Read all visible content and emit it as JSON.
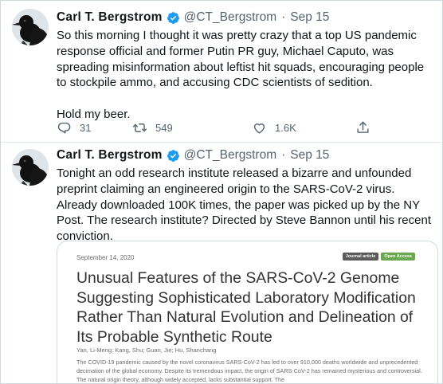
{
  "tweets": [
    {
      "author": "Carl T. Bergstrom",
      "handle": "@CT_Bergstrom",
      "separator": "·",
      "date": "Sep 15",
      "text": "So this morning I thought it was pretty crazy that a top US pandemic response official and former Putin PR guy, Michael Caputo, was spreading misinformation about leftist hit squads, encouraging people to stockpile ammo, and accusing CDC scientists of sedition.\n\nHold my beer.",
      "replies": "31",
      "retweets": "549",
      "likes": "1.6K"
    },
    {
      "author": "Carl T. Bergstrom",
      "handle": "@CT_Bergstrom",
      "separator": "·",
      "date": "Sep 15",
      "text": "Tonight an odd research institute released a bizarre and unfounded preprint claiming an engineered origin to the SARS-CoV-2 virus. Already downloaded 100K times, the paper was picked up by the NY Post. The research institute? Directed by Steve Bannon until his recent conviction."
    }
  ],
  "card": {
    "date": "September 14, 2020",
    "badge_journal": "Journal article",
    "badge_open": "Open Access",
    "title": "Unusual Features of the SARS-CoV-2 Genome Suggesting Sophisticated Laboratory Modification Rather Than Natural Evolution and Delineation of Its Probable Synthetic Route",
    "authors": "Yan, Li-Meng; Kang, Shu; Guan, Jie; Hu, Shanchang",
    "abstract": "The COVID-19 pandemic caused by the novel coronavirus SARS-CoV-2 has led to over 910,000 deaths worldwide and unprecedented decimation of the global economy. Despite its tremendous impact, the origin of SARS-CoV-2 has remained mysterious and controversial. The natural origin theory, although widely accepted, lacks substantial support. The"
  },
  "colors": {
    "verified": "#1d9bf0",
    "secondary_text": "#536471",
    "open_access": "#6aa84f"
  },
  "icons": [
    "crow-avatar-icon",
    "verified-badge-icon",
    "reply-icon",
    "retweet-icon",
    "like-icon",
    "share-icon"
  ]
}
